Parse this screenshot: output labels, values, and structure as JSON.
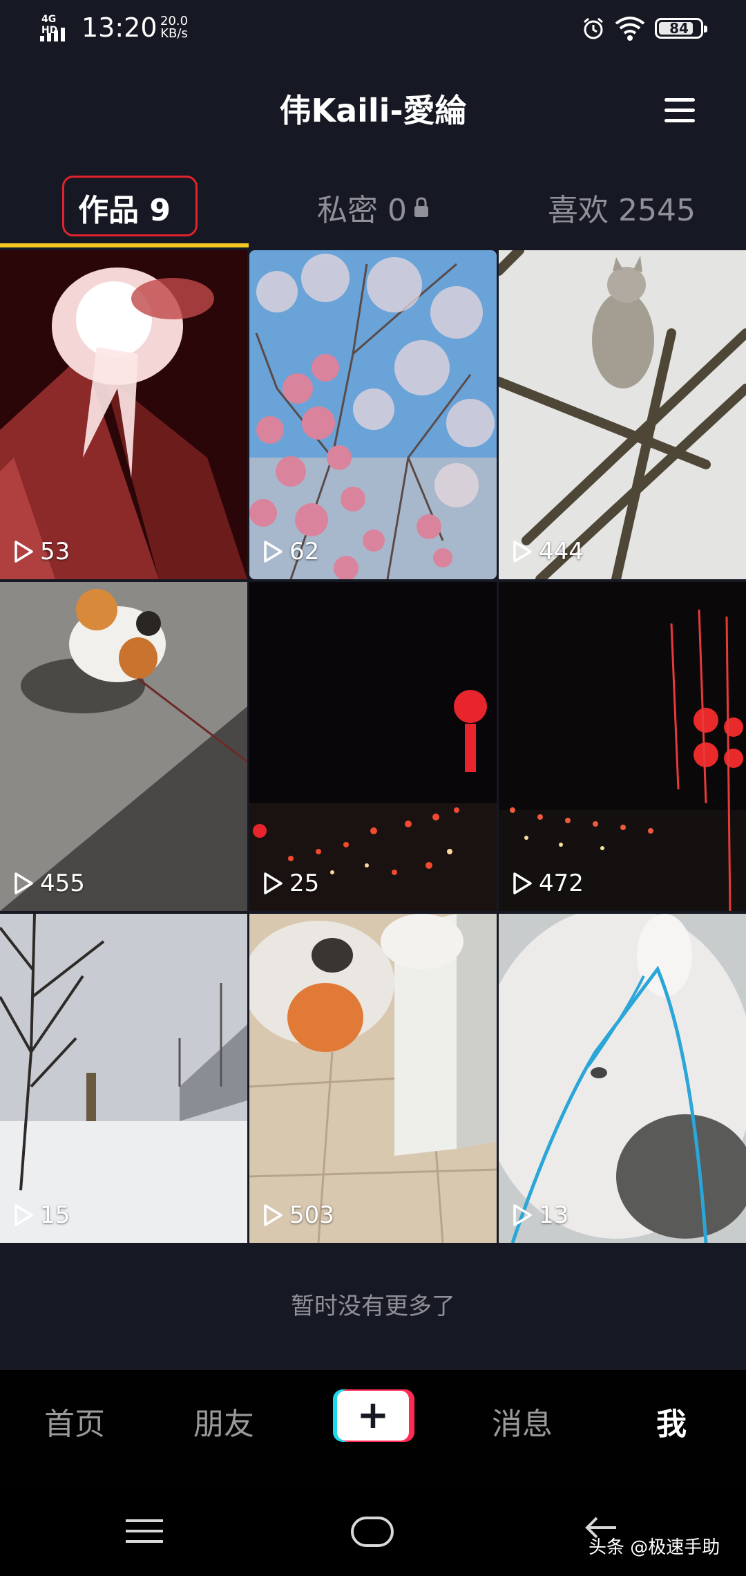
{
  "status_bar": {
    "network": "4G HD",
    "time": "13:20",
    "speed_value": "20.0",
    "speed_unit": "KB/s",
    "battery": "84",
    "battery_level": 0.84
  },
  "header": {
    "title": "伟Kaili-愛綸"
  },
  "tabs": [
    {
      "label": "作品 9",
      "active": true
    },
    {
      "label": "私密 0",
      "active": false
    },
    {
      "label": "喜欢 2545",
      "active": false
    }
  ],
  "colors": {
    "background": "#161823",
    "tab_underline": "#f5c722",
    "highlight_red": "#e0242c",
    "plus_cyan": "#20d5ec",
    "plus_pink": "#fe2c55"
  },
  "videos": [
    {
      "plays": "53",
      "subject": "fire"
    },
    {
      "plays": "62",
      "subject": "magnolia-blossoms"
    },
    {
      "plays": "444",
      "subject": "cat-on-bamboo"
    },
    {
      "plays": "455",
      "subject": "cat-on-pavement"
    },
    {
      "plays": "25",
      "subject": "night-lanterns"
    },
    {
      "plays": "472",
      "subject": "night-street-lights"
    },
    {
      "plays": "15",
      "subject": "snowy-field"
    },
    {
      "plays": "503",
      "subject": "cat-on-tiles"
    },
    {
      "plays": "13",
      "subject": "white-cat"
    }
  ],
  "footer_text": "暂时没有更多了",
  "bottom_nav": {
    "home": "首页",
    "friends": "朋友",
    "plus": "+",
    "messages": "消息",
    "me": "我"
  },
  "watermark": "头条 @极速手助"
}
